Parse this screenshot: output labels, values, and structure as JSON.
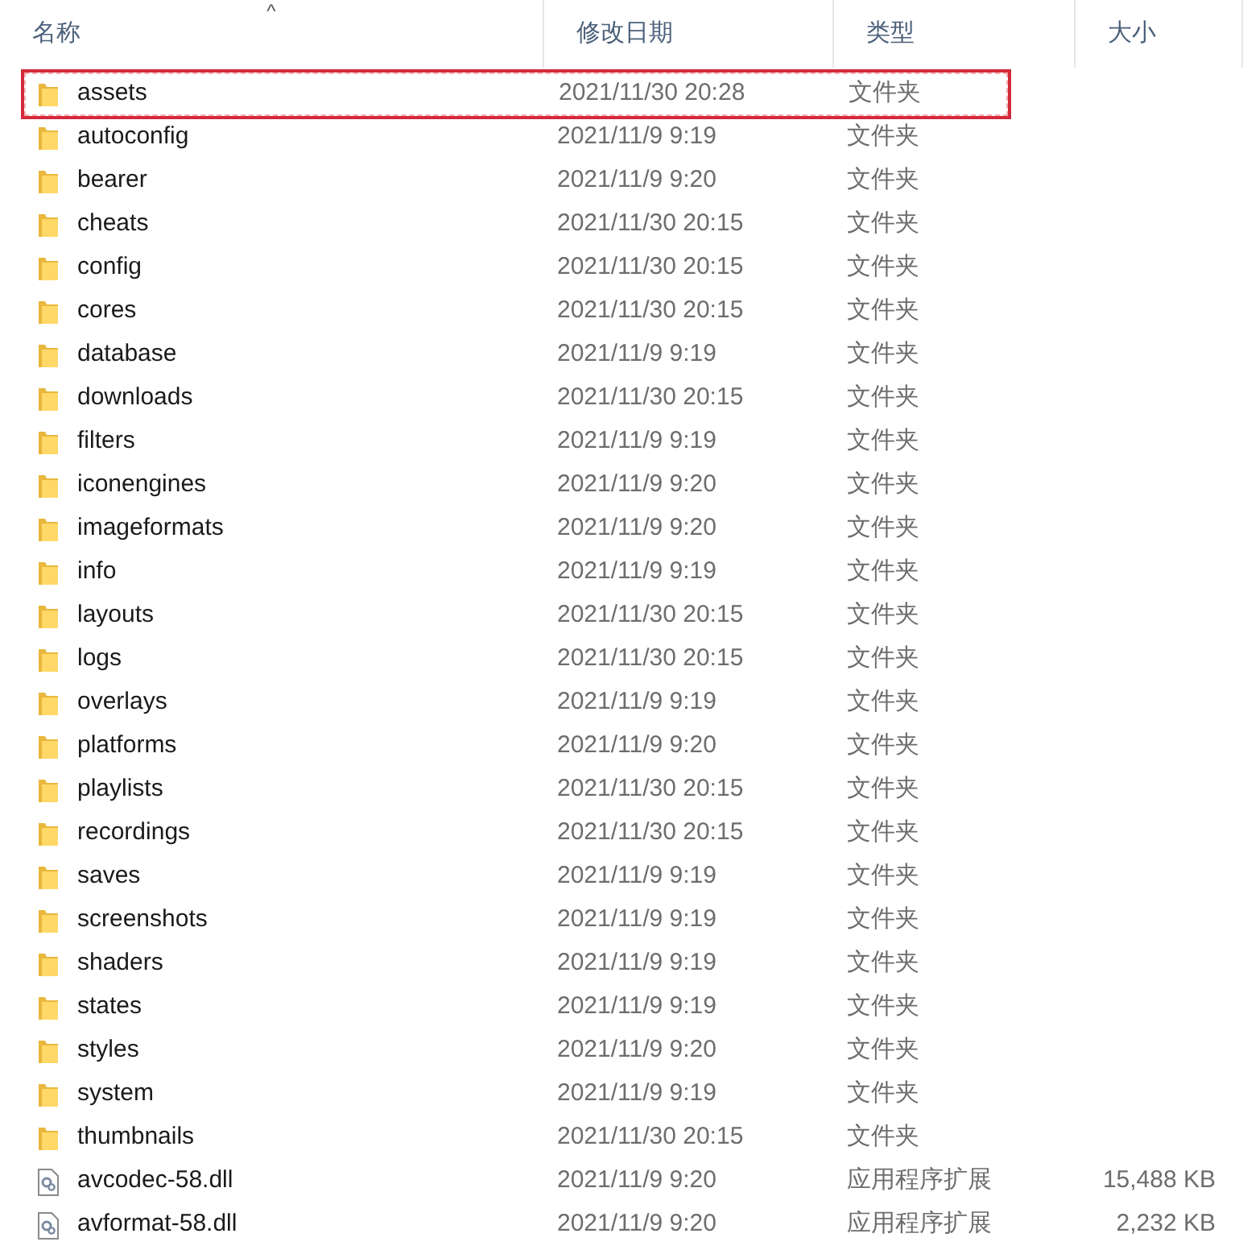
{
  "columns": [
    {
      "label": "名称",
      "sorted": true
    },
    {
      "label": "修改日期",
      "sorted": false
    },
    {
      "label": "类型",
      "sorted": false
    },
    {
      "label": "大小",
      "sorted": false
    }
  ],
  "sort_indicator": "^",
  "rows": [
    {
      "kind": "folder",
      "name": "assets",
      "date": "2021/11/30 20:28",
      "type": "文件夹",
      "highlighted": true
    },
    {
      "kind": "folder",
      "name": "autoconfig",
      "date": "2021/11/9 9:19",
      "type": "文件夹",
      "highlighted": false
    },
    {
      "kind": "folder",
      "name": "bearer",
      "date": "2021/11/9 9:20",
      "type": "文件夹",
      "highlighted": false
    },
    {
      "kind": "folder",
      "name": "cheats",
      "date": "2021/11/30 20:15",
      "type": "文件夹",
      "highlighted": false
    },
    {
      "kind": "folder",
      "name": "config",
      "date": "2021/11/30 20:15",
      "type": "文件夹",
      "highlighted": false
    },
    {
      "kind": "folder",
      "name": "cores",
      "date": "2021/11/30 20:15",
      "type": "文件夹",
      "highlighted": false
    },
    {
      "kind": "folder",
      "name": "database",
      "date": "2021/11/9 9:19",
      "type": "文件夹",
      "highlighted": false
    },
    {
      "kind": "folder",
      "name": "downloads",
      "date": "2021/11/30 20:15",
      "type": "文件夹",
      "highlighted": false
    },
    {
      "kind": "folder",
      "name": "filters",
      "date": "2021/11/9 9:19",
      "type": "文件夹",
      "highlighted": false
    },
    {
      "kind": "folder",
      "name": "iconengines",
      "date": "2021/11/9 9:20",
      "type": "文件夹",
      "highlighted": false
    },
    {
      "kind": "folder",
      "name": "imageformats",
      "date": "2021/11/9 9:20",
      "type": "文件夹",
      "highlighted": false
    },
    {
      "kind": "folder",
      "name": "info",
      "date": "2021/11/9 9:19",
      "type": "文件夹",
      "highlighted": false
    },
    {
      "kind": "folder",
      "name": "layouts",
      "date": "2021/11/30 20:15",
      "type": "文件夹",
      "highlighted": false
    },
    {
      "kind": "folder",
      "name": "logs",
      "date": "2021/11/30 20:15",
      "type": "文件夹",
      "highlighted": false
    },
    {
      "kind": "folder",
      "name": "overlays",
      "date": "2021/11/9 9:19",
      "type": "文件夹",
      "highlighted": false
    },
    {
      "kind": "folder",
      "name": "platforms",
      "date": "2021/11/9 9:20",
      "type": "文件夹",
      "highlighted": false
    },
    {
      "kind": "folder",
      "name": "playlists",
      "date": "2021/11/30 20:15",
      "type": "文件夹",
      "highlighted": false
    },
    {
      "kind": "folder",
      "name": "recordings",
      "date": "2021/11/30 20:15",
      "type": "文件夹",
      "highlighted": false
    },
    {
      "kind": "folder",
      "name": "saves",
      "date": "2021/11/9 9:19",
      "type": "文件夹",
      "highlighted": false
    },
    {
      "kind": "folder",
      "name": "screenshots",
      "date": "2021/11/9 9:19",
      "type": "文件夹",
      "highlighted": false
    },
    {
      "kind": "folder",
      "name": "shaders",
      "date": "2021/11/9 9:19",
      "type": "文件夹",
      "highlighted": false
    },
    {
      "kind": "folder",
      "name": "states",
      "date": "2021/11/9 9:19",
      "type": "文件夹",
      "highlighted": false
    },
    {
      "kind": "folder",
      "name": "styles",
      "date": "2021/11/9 9:20",
      "type": "文件夹",
      "highlighted": false
    },
    {
      "kind": "folder",
      "name": "system",
      "date": "2021/11/9 9:19",
      "type": "文件夹",
      "highlighted": false
    },
    {
      "kind": "folder",
      "name": "thumbnails",
      "date": "2021/11/30 20:15",
      "type": "文件夹",
      "highlighted": false
    },
    {
      "kind": "dll",
      "name": "avcodec-58.dll",
      "date": "2021/11/9 9:20",
      "type": "应用程序扩展",
      "size": "15,488 KB",
      "highlighted": false
    },
    {
      "kind": "dll",
      "name": "avformat-58.dll",
      "date": "2021/11/9 9:20",
      "type": "应用程序扩展",
      "size": "2,232 KB",
      "highlighted": false
    }
  ]
}
